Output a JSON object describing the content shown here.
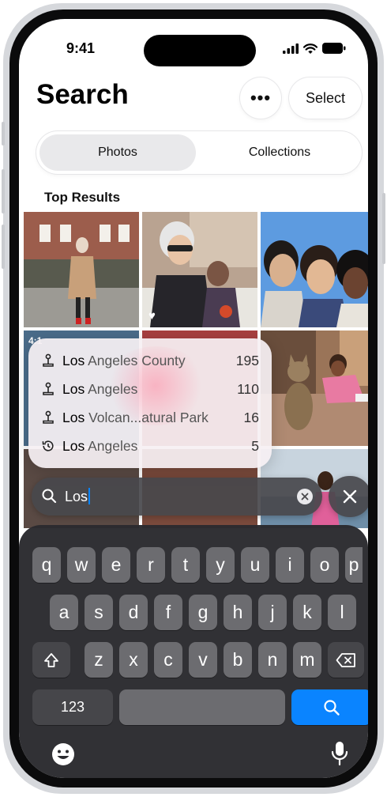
{
  "status_bar": {
    "time": "9:41"
  },
  "header": {
    "title": "Search",
    "more_label": "•••",
    "select_label": "Select"
  },
  "segments": [
    {
      "label": "Photos"
    },
    {
      "label": "Collections"
    }
  ],
  "section": {
    "title": "Top Results"
  },
  "suggestions": [
    {
      "icon": "landmark-icon",
      "match": "Los",
      "rest": " Angeles County",
      "count": "195"
    },
    {
      "icon": "landmark-icon",
      "match": "Los",
      "rest": " Angeles",
      "count": "110"
    },
    {
      "icon": "landmark-icon",
      "match": "Los",
      "rest": " Volcan...atural Park",
      "count": "16"
    },
    {
      "icon": "recent-search-icon",
      "match": "Los",
      "rest": " Angeles",
      "count": "5"
    }
  ],
  "search": {
    "value": "Los"
  },
  "keyboard": {
    "row1": [
      "q",
      "w",
      "e",
      "r",
      "t",
      "y",
      "u",
      "i",
      "o",
      "p"
    ],
    "row2": [
      "a",
      "s",
      "d",
      "f",
      "g",
      "h",
      "j",
      "k",
      "l"
    ],
    "row3": [
      "z",
      "x",
      "c",
      "v",
      "b",
      "n",
      "m"
    ],
    "numbers_label": "123"
  },
  "photo_badge": "4:1",
  "colors": {
    "accent": "#0a84ff",
    "keyboard_bg": "#2a2a2e",
    "key_bg": "#6c6c70"
  }
}
